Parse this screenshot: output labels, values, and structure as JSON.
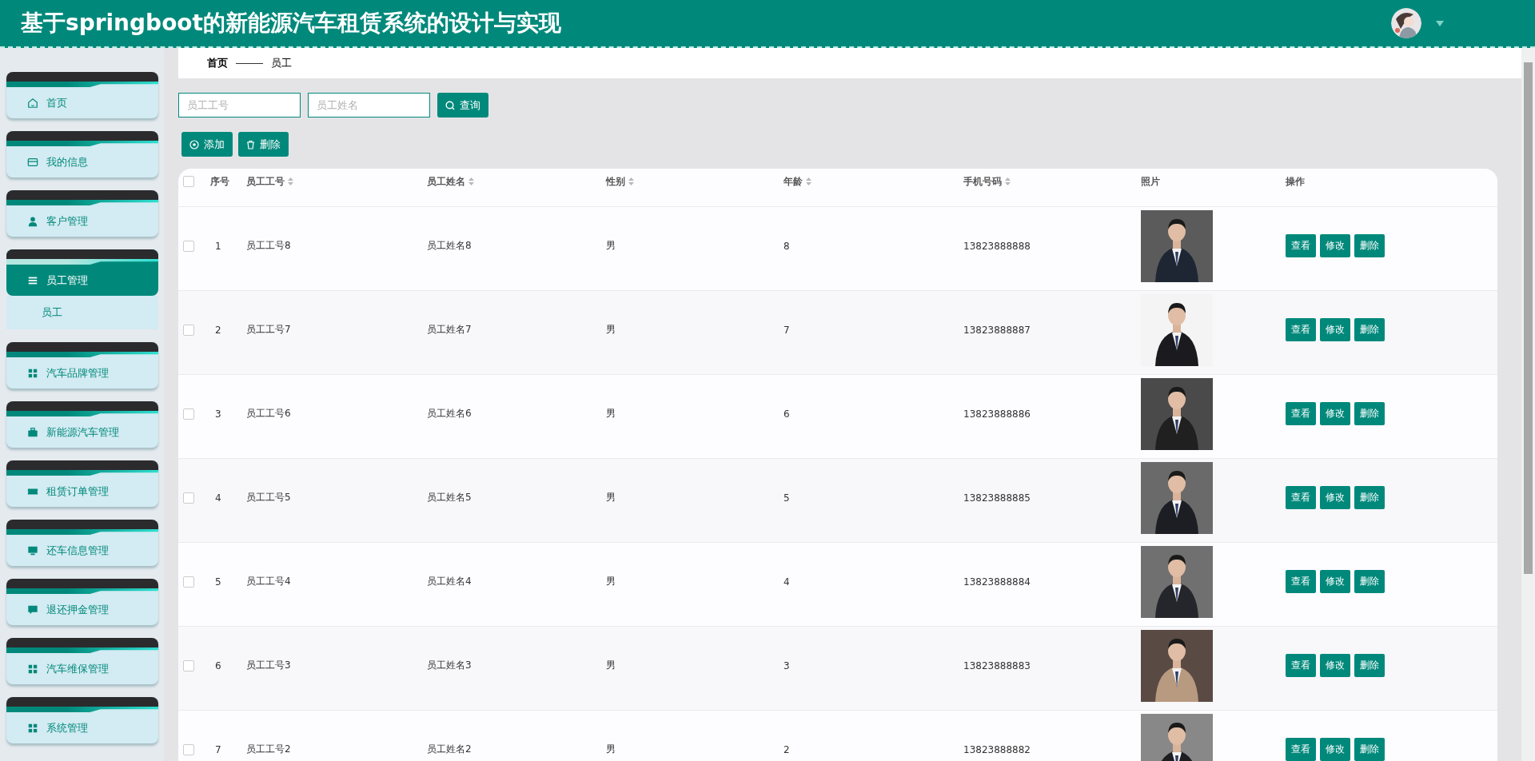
{
  "header": {
    "title": "基于springboot的新能源汽车租赁系统的设计与实现"
  },
  "sidebar": {
    "items": [
      {
        "label": "首页",
        "selected": false
      },
      {
        "label": "我的信息",
        "selected": false
      },
      {
        "label": "客户管理",
        "selected": false
      },
      {
        "label": "员工管理",
        "selected": true,
        "children": [
          {
            "label": "员工"
          }
        ]
      },
      {
        "label": "汽车品牌管理",
        "selected": false
      },
      {
        "label": "新能源汽车管理",
        "selected": false
      },
      {
        "label": "租赁订单管理",
        "selected": false
      },
      {
        "label": "还车信息管理",
        "selected": false
      },
      {
        "label": "退还押金管理",
        "selected": false
      },
      {
        "label": "汽车维保管理",
        "selected": false
      },
      {
        "label": "系统管理",
        "selected": false
      }
    ]
  },
  "breadcrumb": [
    "首页",
    "员工"
  ],
  "search": {
    "fields": [
      {
        "placeholder": "员工工号"
      },
      {
        "placeholder": "员工姓名"
      }
    ],
    "button": "查询"
  },
  "actions": [
    "添加",
    "删除"
  ],
  "table": {
    "select_all_checked": false,
    "columns": [
      {
        "label": "序号",
        "sortable": false
      },
      {
        "label": "员工工号",
        "sortable": true
      },
      {
        "label": "员工姓名",
        "sortable": true
      },
      {
        "label": "性别",
        "sortable": true
      },
      {
        "label": "年龄",
        "sortable": true
      },
      {
        "label": "手机号码",
        "sortable": true
      },
      {
        "label": "照片",
        "sortable": false
      },
      {
        "label": "操作",
        "sortable": false
      }
    ],
    "rows": [
      {
        "index": "1",
        "id": "员工工号8",
        "name": "员工姓名8",
        "gender": "男",
        "age": "8",
        "phone": "13823888888",
        "checked": false,
        "actions": [
          "查看",
          "修改",
          "删除"
        ]
      },
      {
        "index": "2",
        "id": "员工工号7",
        "name": "员工姓名7",
        "gender": "男",
        "age": "7",
        "phone": "13823888887",
        "checked": false,
        "actions": [
          "查看",
          "修改",
          "删除"
        ]
      },
      {
        "index": "3",
        "id": "员工工号6",
        "name": "员工姓名6",
        "gender": "男",
        "age": "6",
        "phone": "13823888886",
        "checked": false,
        "actions": [
          "查看",
          "修改",
          "删除"
        ]
      },
      {
        "index": "4",
        "id": "员工工号5",
        "name": "员工姓名5",
        "gender": "男",
        "age": "5",
        "phone": "13823888885",
        "checked": false,
        "actions": [
          "查看",
          "修改",
          "删除"
        ]
      },
      {
        "index": "5",
        "id": "员工工号4",
        "name": "员工姓名4",
        "gender": "男",
        "age": "4",
        "phone": "13823888884",
        "checked": false,
        "actions": [
          "查看",
          "修改",
          "删除"
        ]
      },
      {
        "index": "6",
        "id": "员工工号3",
        "name": "员工姓名3",
        "gender": "男",
        "age": "3",
        "phone": "13823888883",
        "checked": false,
        "actions": [
          "查看",
          "修改",
          "删除"
        ]
      },
      {
        "index": "7",
        "id": "员工工号2",
        "name": "员工姓名2",
        "gender": "男",
        "age": "2",
        "phone": "13823888882",
        "checked": false,
        "actions": [
          "查看",
          "修改",
          "删除"
        ]
      }
    ]
  }
}
